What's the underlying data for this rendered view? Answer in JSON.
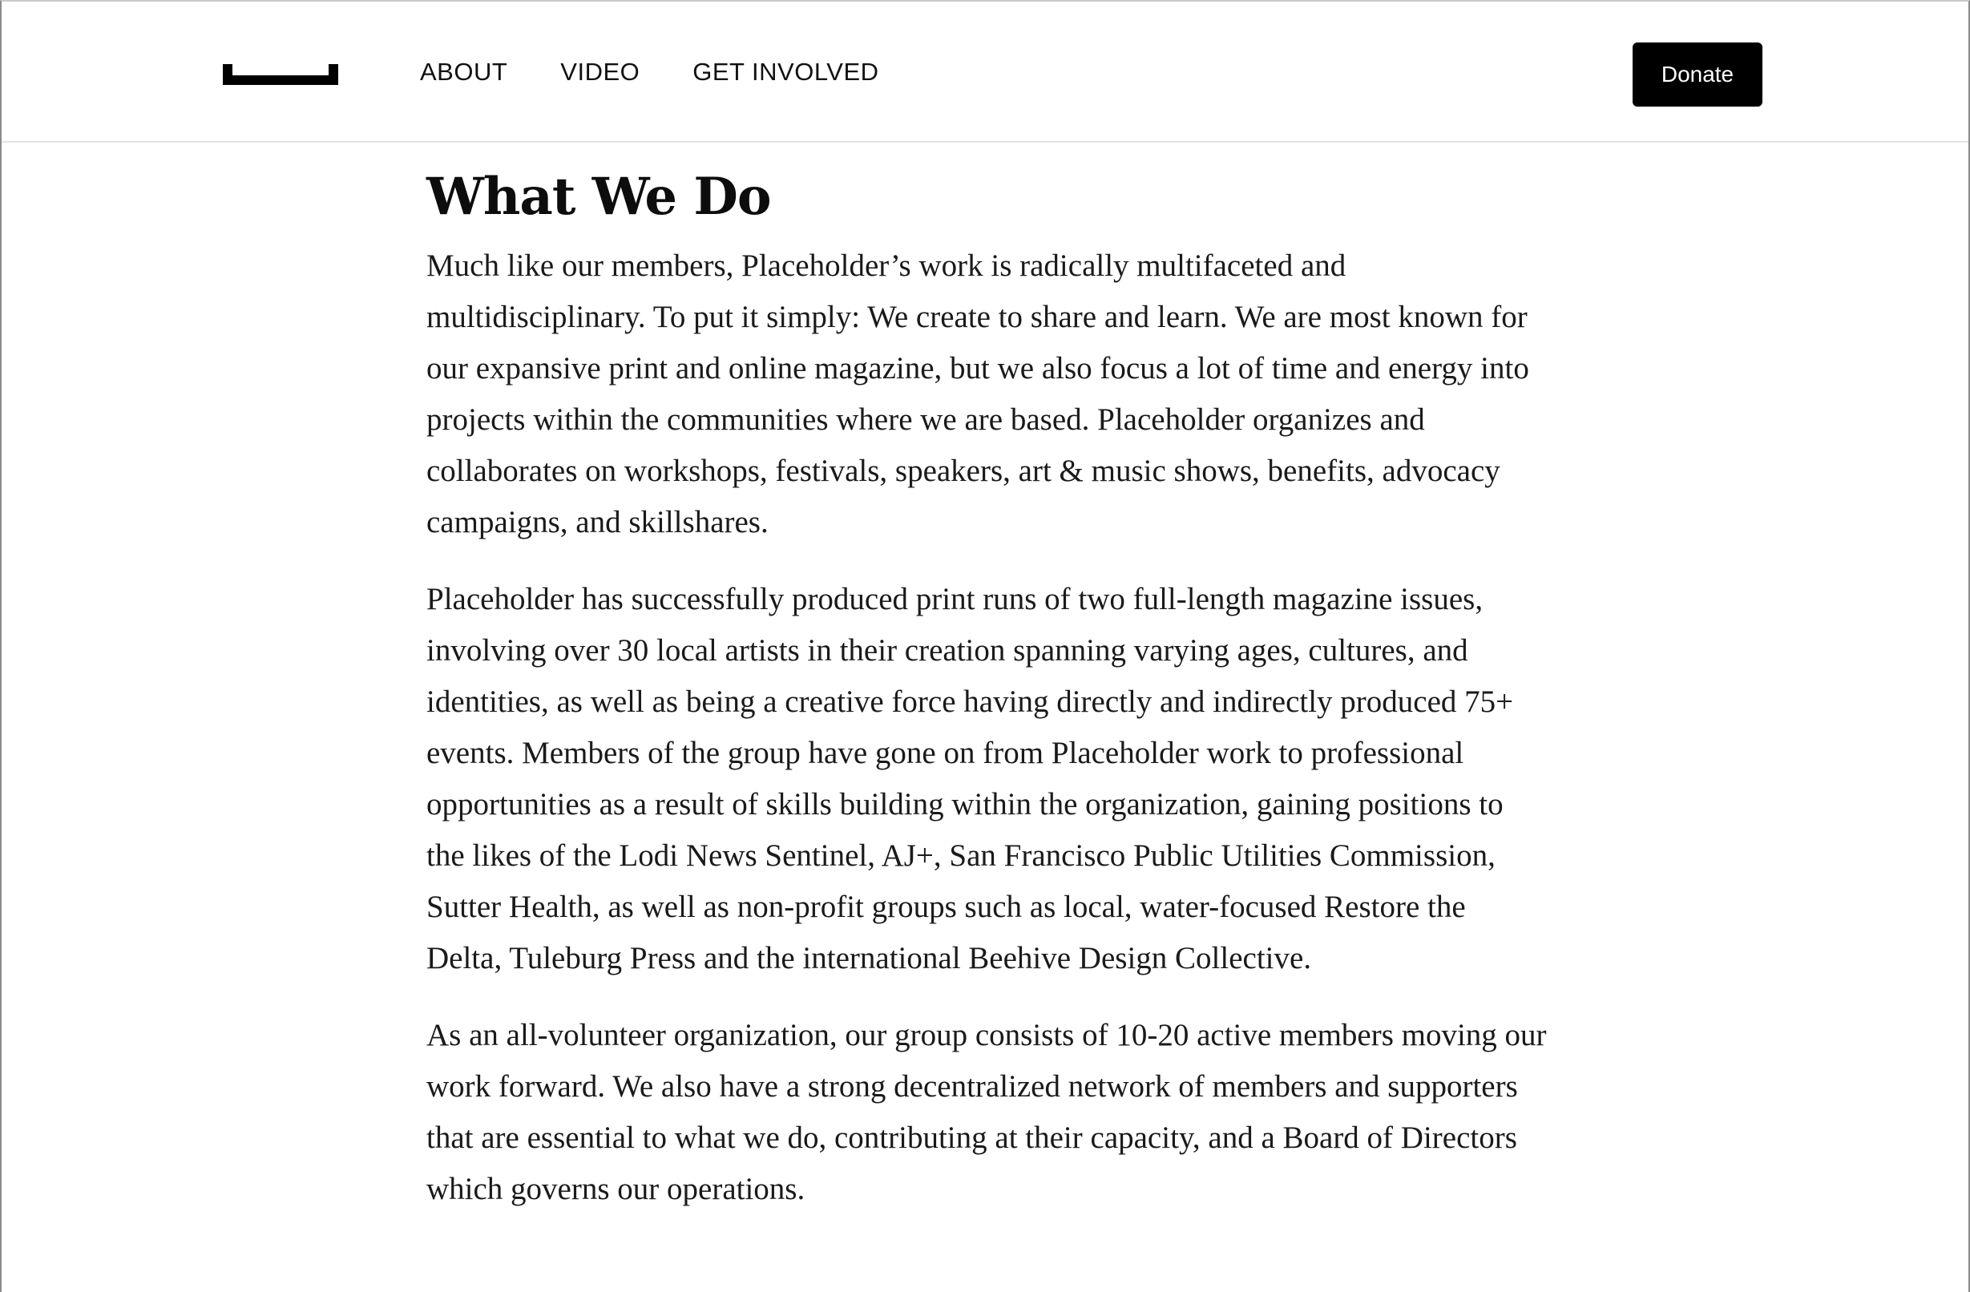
{
  "header": {
    "nav": [
      {
        "label": "ABOUT"
      },
      {
        "label": "VIDEO"
      },
      {
        "label": "GET INVOLVED"
      }
    ],
    "donate_label": "Donate"
  },
  "main": {
    "title": "What We Do",
    "paragraphs": [
      "Much like our members, Placeholder’s work is radically multifaceted and multidisciplinary. To put it simply: We create to share and learn. We are most known for our expansive print and online magazine, but we also focus a lot of time and energy into projects within the communities where we are based. Placeholder organizes and collaborates on workshops, festivals, speakers, art & music shows, benefits, advocacy campaigns, and skillshares.",
      "Placeholder has successfully produced print runs of two full-length magazine issues, involving over 30 local artists in their creation spanning varying ages, cultures, and identities, as well as being a creative force having directly and indirectly produced 75+ events. Members of the group have gone on from Placeholder work to professional opportunities as a result of skills building within the organization, gaining positions to the likes of the Lodi News Sentinel, AJ+, San Francisco Public Utilities Commission, Sutter Health, as well as non-profit groups such as local, water-focused Restore the Delta, Tuleburg Press and the international Beehive Design Collective.",
      "As an all-volunteer organization, our group consists of 10-20 active members moving our work forward. We also have a strong decentralized network of members and supporters that are essential to what we do, contributing at their capacity, and a Board of Directors which governs our operations."
    ]
  },
  "colors": {
    "accent": "#000000",
    "background": "#ffffff",
    "text": "#111111"
  }
}
